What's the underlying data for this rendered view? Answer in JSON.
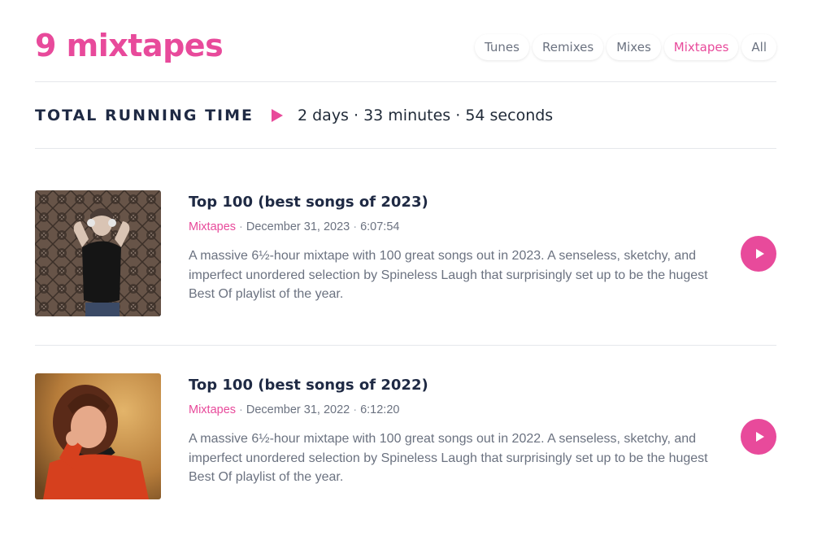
{
  "header": {
    "title": "9 mixtapes",
    "filters": [
      {
        "label": "Tunes",
        "active": false
      },
      {
        "label": "Remixes",
        "active": false
      },
      {
        "label": "Mixes",
        "active": false
      },
      {
        "label": "Mixtapes",
        "active": true
      },
      {
        "label": "All",
        "active": false
      }
    ]
  },
  "summary": {
    "label": "TOTAL RUNNING TIME",
    "value": "2 days · 33 minutes · 54 seconds"
  },
  "items": [
    {
      "title": "Top 100 (best songs of 2023)",
      "category": "Mixtapes",
      "date": "December 31, 2023",
      "duration": "6:07:54",
      "description": "A massive 6½-hour mixtape with 100 great songs out in 2023. A senseless, sketchy, and imperfect unordered selection by Spineless Laugh that surprisingly set up to be the hugest Best Of playlist of the year."
    },
    {
      "title": "Top 100 (best songs of 2022)",
      "category": "Mixtapes",
      "date": "December 31, 2022",
      "duration": "6:12:20",
      "description": "A massive 6½-hour mixtape with 100 great songs out in 2022. A senseless, sketchy, and imperfect unordered selection by Spineless Laugh that surprisingly set up to be the hugest Best Of playlist of the year."
    }
  ],
  "colors": {
    "accent": "#e84a9b",
    "heading": "#1f2a44",
    "muted": "#6b7280",
    "divider": "#e5e7eb"
  },
  "icons": {
    "play": "play-icon"
  }
}
